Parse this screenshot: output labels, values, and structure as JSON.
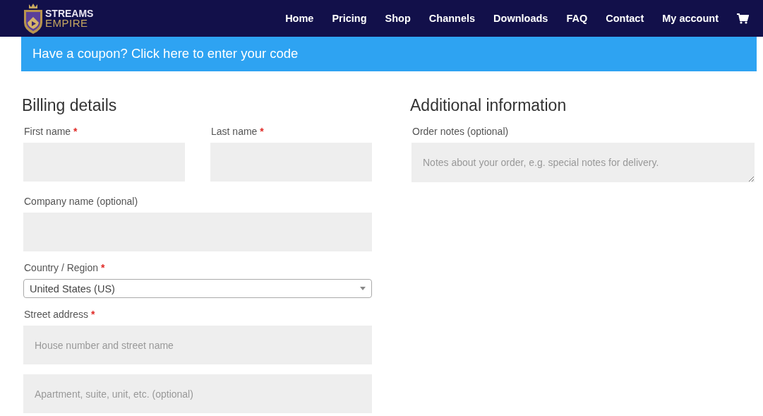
{
  "header": {
    "logo": [
      "STREAMS",
      "EMPIRE"
    ],
    "nav": [
      {
        "label": "Home"
      },
      {
        "label": "Pricing"
      },
      {
        "label": "Shop"
      },
      {
        "label": "Channels"
      },
      {
        "label": "Downloads"
      },
      {
        "label": "FAQ"
      },
      {
        "label": "Contact"
      },
      {
        "label": "My account"
      }
    ]
  },
  "coupon": {
    "text": "Have a coupon? Click here to enter your code"
  },
  "billing": {
    "title": "Billing details",
    "name_row": [
      {
        "label": "First name",
        "required_mark": "*",
        "kind": "text"
      },
      {
        "label": "Last name",
        "required_mark": "*",
        "kind": "text"
      }
    ],
    "fields": [
      {
        "label": "Company name (optional)",
        "kind": "text"
      },
      {
        "label": "Country / Region",
        "required_mark": "*",
        "kind": "select",
        "value": "United States (US)"
      },
      {
        "label": "Street address",
        "required_mark": "*",
        "kind": "text",
        "placeholder": "House number and street name"
      },
      {
        "kind": "text",
        "placeholder": "Apartment, suite, unit, etc. (optional)"
      }
    ]
  },
  "additional": {
    "title": "Additional information",
    "fields": [
      {
        "label": "Order notes (optional)",
        "kind": "textarea",
        "placeholder": "Notes about your order, e.g. special notes for delivery."
      }
    ]
  }
}
